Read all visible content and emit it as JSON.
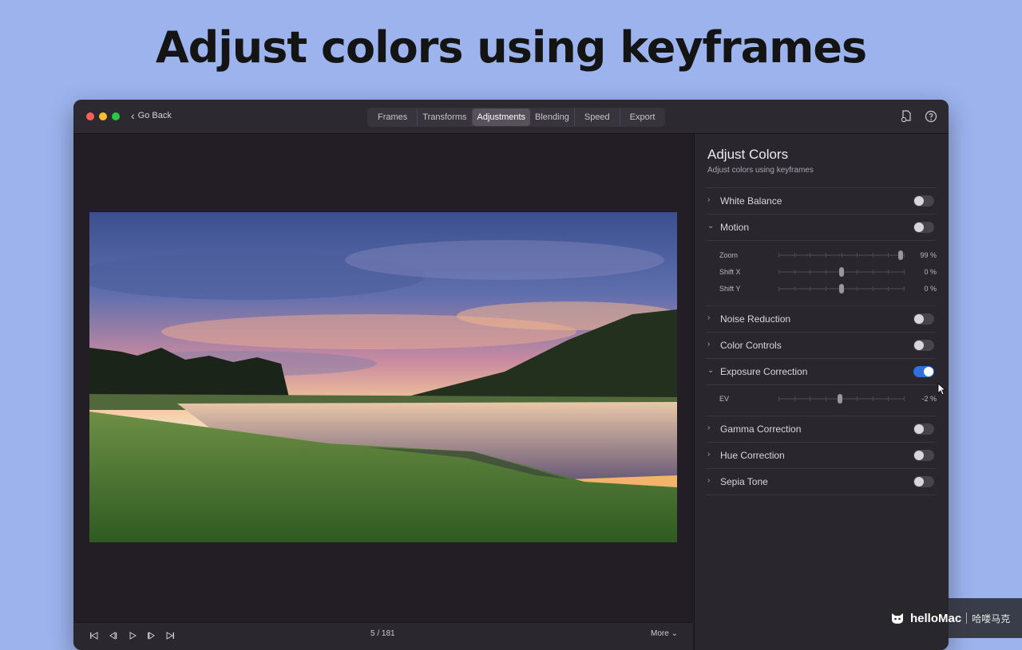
{
  "headline": "Adjust colors using keyframes",
  "window": {
    "go_back": "Go Back",
    "tabs": [
      {
        "label": "Frames",
        "active": false
      },
      {
        "label": "Transforms",
        "active": false
      },
      {
        "label": "Adjustments",
        "active": true
      },
      {
        "label": "Blending",
        "active": false
      },
      {
        "label": "Speed",
        "active": false
      },
      {
        "label": "Export",
        "active": false
      }
    ],
    "icons": [
      "file-settings-icon",
      "help-icon"
    ]
  },
  "player": {
    "counter": "5 / 181",
    "more": "More",
    "buttons": [
      "skip-to-start-icon",
      "step-back-icon",
      "play-icon",
      "step-forward-icon",
      "skip-to-end-icon"
    ]
  },
  "panel": {
    "title": "Adjust Colors",
    "subtitle": "Adjust colors using keyframes",
    "sections": [
      {
        "label": "White Balance",
        "expanded": false,
        "enabled": false
      },
      {
        "label": "Motion",
        "expanded": true,
        "enabled": false,
        "params": [
          {
            "label": "Zoom",
            "value": "99 %",
            "level": 0.99
          },
          {
            "label": "Shift X",
            "value": "0 %",
            "level": 0.5
          },
          {
            "label": "Shift Y",
            "value": "0 %",
            "level": 0.5
          }
        ]
      },
      {
        "label": "Noise Reduction",
        "expanded": false,
        "enabled": false
      },
      {
        "label": "Color Controls",
        "expanded": false,
        "enabled": false
      },
      {
        "label": "Exposure Correction",
        "expanded": true,
        "enabled": true,
        "params": [
          {
            "label": "EV",
            "value": "-2 %",
            "level": 0.49
          }
        ]
      },
      {
        "label": "Gamma Correction",
        "expanded": false,
        "enabled": false
      },
      {
        "label": "Hue Correction",
        "expanded": false,
        "enabled": false
      },
      {
        "label": "Sepia Tone",
        "expanded": false,
        "enabled": false
      }
    ]
  },
  "watermark": {
    "brand": "helloMac",
    "cn": "哈喽马克"
  }
}
